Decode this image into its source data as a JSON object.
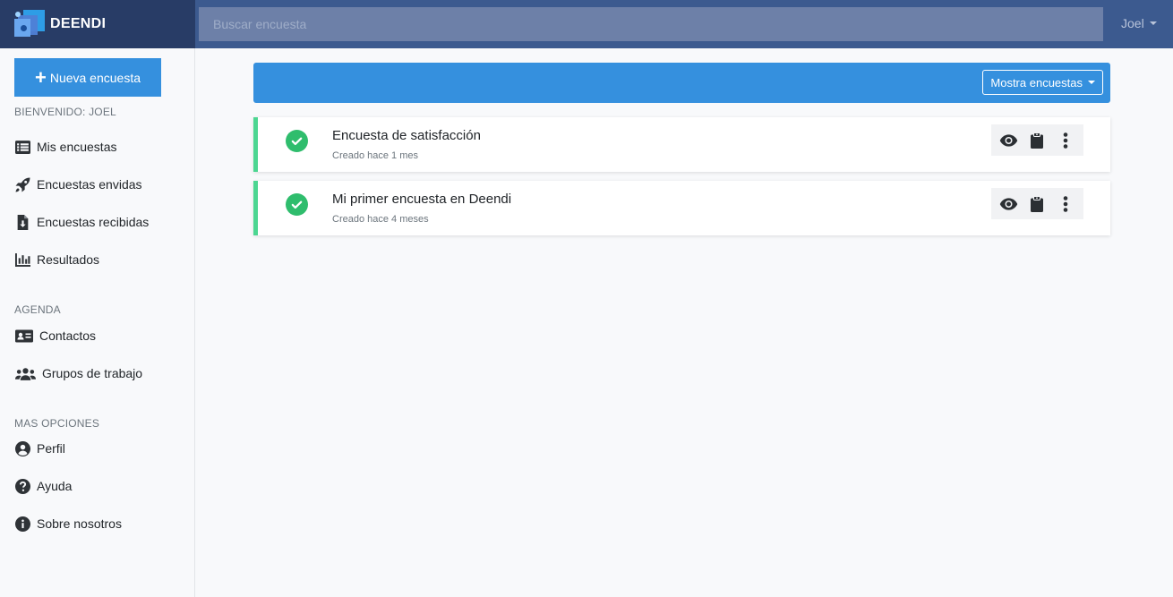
{
  "brand": {
    "name": "DEENDI"
  },
  "search": {
    "placeholder": "Buscar encuesta",
    "value": ""
  },
  "user": {
    "name": "Joel"
  },
  "sidebar": {
    "new_button": "Nueva encuesta",
    "welcome": "BIENVENIDO: JOEL",
    "main_items": [
      {
        "label": "Mis encuestas",
        "icon": "list-icon"
      },
      {
        "label": "Encuestas envidas",
        "icon": "rocket-icon"
      },
      {
        "label": "Encuestas recibidas",
        "icon": "file-download-icon"
      },
      {
        "label": "Resultados",
        "icon": "chart-bar-icon"
      }
    ],
    "agenda_label": "AGENDA",
    "agenda_items": [
      {
        "label": "Contactos",
        "icon": "id-card-icon"
      },
      {
        "label": "Grupos de trabajo",
        "icon": "users-icon"
      }
    ],
    "more_label": "MAS OPCIONES",
    "more_items": [
      {
        "label": "Perfil",
        "icon": "user-circle-icon"
      },
      {
        "label": "Ayuda",
        "icon": "question-circle-icon"
      },
      {
        "label": "Sobre nosotros",
        "icon": "info-circle-icon"
      }
    ]
  },
  "main": {
    "filter_button": "Mostra encuestas",
    "surveys": [
      {
        "title": "Encuesta de satisfacción",
        "created": "Creado hace 1 mes",
        "status": "completed"
      },
      {
        "title": "Mi primer encuesta en Deendi",
        "created": "Creado hace 4 meses",
        "status": "completed"
      }
    ]
  },
  "colors": {
    "topbar": "#3c5a8f",
    "brand_bg": "#283c66",
    "primary": "#3590de",
    "success": "#2fbd6d",
    "card_accent": "#4cd691"
  }
}
